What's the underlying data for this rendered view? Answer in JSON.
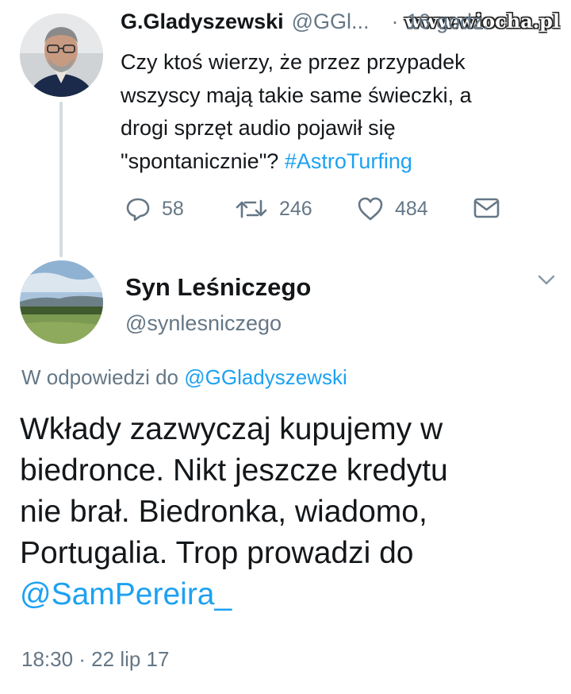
{
  "watermark": "www.wiocha.pl",
  "parent_tweet": {
    "author_name": "G.Gladyszewski",
    "author_handle": "@GGl...",
    "separator": "·",
    "time": "16 godz.",
    "text_lines": [
      "Czy ktoś wierzy, że przez przypadek",
      "wszyscy mają takie same świeczki, a",
      "drogi sprzęt audio pojawił się"
    ],
    "text_last_line": "\"spontanicznie\"? ",
    "hashtag": "#AstroTurfing",
    "actions": {
      "replies": "58",
      "retweets": "246",
      "likes": "484"
    }
  },
  "reply_tweet": {
    "author_name": "Syn Leśniczego",
    "author_handle": "@synlesniczego",
    "in_reply_prefix": "W odpowiedzi do ",
    "in_reply_handle": "@GGladyszewski",
    "text_lines": [
      "Wkłady zazwyczaj kupujemy w",
      "biedronce. Nikt jeszcze kredytu",
      "nie brał. Biedronka, wiadomo,",
      "Portugalia. Trop prowadzi do"
    ],
    "mention": "@SamPereira_",
    "timestamp": "18:30 · 22 lip 17"
  },
  "colors": {
    "link": "#1da1f2",
    "secondary_text": "#657786",
    "primary_text": "#14171a",
    "thread_line": "#d5dbe0"
  },
  "icons": [
    "reply-icon",
    "retweet-icon",
    "like-icon",
    "message-icon",
    "chevron-down-icon"
  ]
}
